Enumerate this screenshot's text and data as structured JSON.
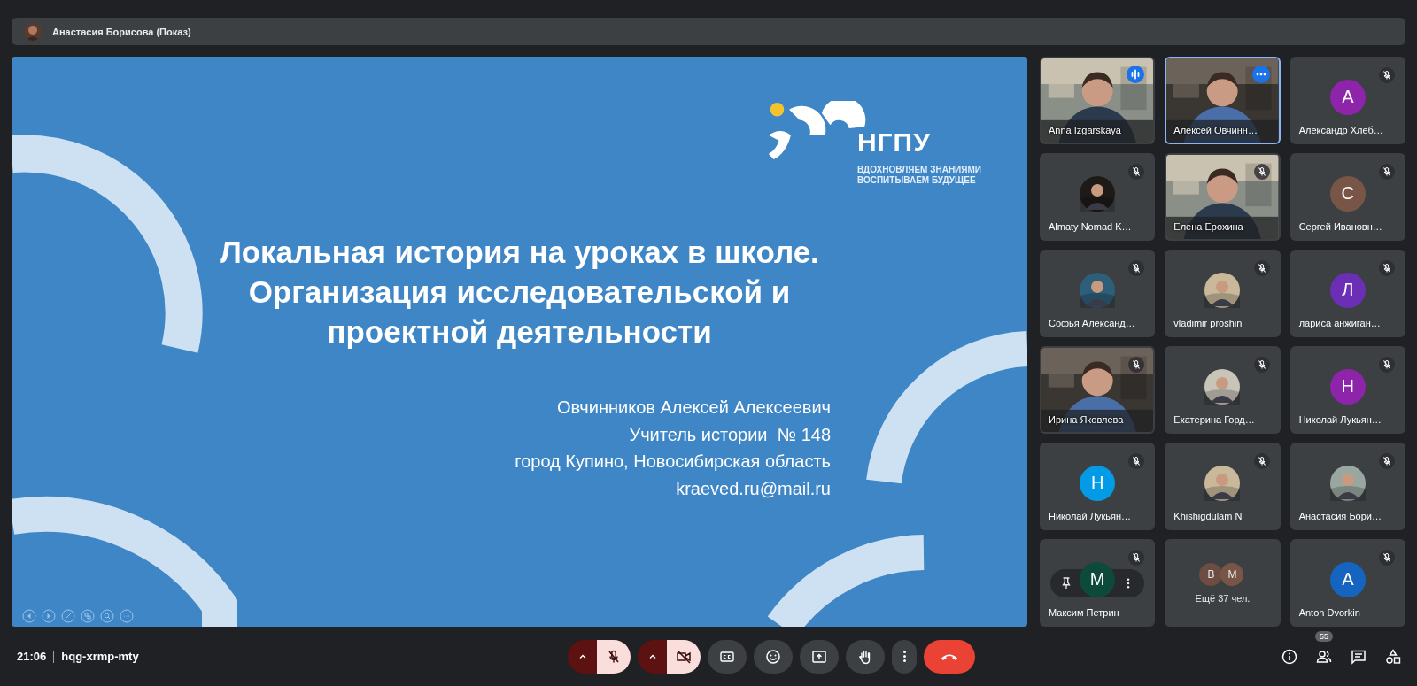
{
  "presenter_bar": {
    "name": "Анастасия Борисова (Показ)"
  },
  "slide": {
    "logo": {
      "wordmark": "НГПУ",
      "tagline": [
        "ВДОХНОВЛЯЕМ ЗНАНИЯМИ",
        "ВОСПИТЫВАЕМ БУДУЩЕЕ"
      ]
    },
    "title": [
      "Локальная история на уроках в школе.",
      "Организация исследовательской и",
      "проектной деятельности"
    ],
    "author": [
      "Овчинников Алексей Алексеевич",
      "Учитель истории  № 148",
      "город Купино, Новосибирская область",
      "kraeved.ru@mail.ru"
    ]
  },
  "participants": [
    {
      "kind": "video",
      "name": "Anna Izgarskaya",
      "muted": false,
      "speaking": true,
      "selected": false,
      "hovered": false
    },
    {
      "kind": "video",
      "name": "Алексей Овчинн…",
      "muted": false,
      "speaking": false,
      "selected": true,
      "hovered": false
    },
    {
      "kind": "letter",
      "initial": "А",
      "color": "#8e24aa",
      "name": "Александр Хлеб…",
      "muted": true,
      "speaking": false,
      "selected": false,
      "hovered": false
    },
    {
      "name": "Almaty Nomad K…",
      "muted": true,
      "speaking": false,
      "selected": false,
      "hovered": false
    },
    {
      "kind": "video",
      "name": "Елена Ерохина",
      "muted": true,
      "speaking": false,
      "selected": false,
      "hovered": false
    },
    {
      "kind": "letter",
      "initial": "С",
      "color": "#795548",
      "name": "Сергей Ивановн…",
      "muted": true,
      "speaking": false,
      "selected": false,
      "hovered": false
    },
    {
      "name": "Софья Александ…",
      "muted": true,
      "speaking": false,
      "selected": false,
      "hovered": false
    },
    {
      "name": "vladimir proshin",
      "muted": true,
      "speaking": false,
      "selected": false,
      "hovered": false
    },
    {
      "kind": "letter",
      "initial": "Л",
      "color": "#6a2fb5",
      "name": "лариса анжиган…",
      "muted": true,
      "speaking": false,
      "selected": false,
      "hovered": false
    },
    {
      "kind": "video",
      "name": "Ирина Яковлева",
      "muted": true,
      "speaking": false,
      "selected": false,
      "hovered": false
    },
    {
      "name": "Екатерина Горд…",
      "muted": true,
      "speaking": false,
      "selected": false,
      "hovered": false
    },
    {
      "kind": "letter",
      "initial": "Н",
      "color": "#8e24aa",
      "name": "Николай Лукьян…",
      "muted": true,
      "speaking": false,
      "selected": false,
      "hovered": false
    },
    {
      "kind": "letter",
      "initial": "Н",
      "color": "#039be5",
      "name": "Николай Лукьян…",
      "muted": true,
      "speaking": false,
      "selected": false,
      "hovered": false
    },
    {
      "name": "Khishigdulam N",
      "muted": true,
      "speaking": false,
      "selected": false,
      "hovered": false
    },
    {
      "name": "Анастасия Бори…",
      "muted": true,
      "speaking": false,
      "selected": false,
      "hovered": false
    },
    {
      "kind": "letter",
      "initial": "М",
      "color": "#0d4a3c",
      "name": "Максим Петрин",
      "muted": true,
      "speaking": false,
      "selected": false,
      "hovered": true
    },
    {
      "kind": "more",
      "initials": [
        {
          "letter": "В",
          "color": "#6d4c41"
        },
        {
          "letter": "М",
          "color": "#795548"
        }
      ],
      "label": "Ещё 37 чел.",
      "muted": false,
      "speaking": false,
      "selected": false,
      "hovered": false
    },
    {
      "kind": "letter",
      "initial": "А",
      "color": "#1565c0",
      "name": "Anton Dvorkin",
      "muted": true,
      "speaking": false,
      "selected": false,
      "hovered": false
    }
  ],
  "meeting": {
    "time": "21:06",
    "code": "hqg-xrmp-mty"
  },
  "controls": {
    "mic_on": false,
    "camera_on": false
  },
  "people_count": "55"
}
